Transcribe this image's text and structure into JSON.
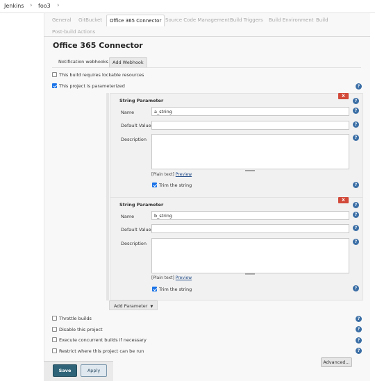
{
  "breadcrumb": {
    "items": [
      "Jenkins",
      "foo3"
    ],
    "separator": "›"
  },
  "tabs": [
    {
      "label": "General",
      "active": false
    },
    {
      "label": "GitBucket",
      "active": false
    },
    {
      "label": "Office 365 Connector",
      "active": true
    },
    {
      "label": "Source Code Management",
      "active": false
    },
    {
      "label": "Build Triggers",
      "active": false
    },
    {
      "label": "Build Environment",
      "active": false
    },
    {
      "label": "Build",
      "active": false
    },
    {
      "label": "Post-build Actions",
      "active": false
    }
  ],
  "section": {
    "title": "Office 365 Connector",
    "subtabs": [
      {
        "label": "Notification webhooks",
        "active": false
      },
      {
        "label": "Add Webhook",
        "active": true
      }
    ]
  },
  "options": {
    "lockable": {
      "label": "This build requires lockable resources",
      "checked": false
    },
    "parameterized": {
      "label": "This project is parameterized",
      "checked": true
    }
  },
  "parameters": [
    {
      "header": "String Parameter",
      "delete_label": "X",
      "name_label": "Name",
      "name_value": "a_string",
      "default_label": "Default Value",
      "default_value": "",
      "description_label": "Description",
      "plain_text": "[Plain text]",
      "preview": "Preview",
      "trim_label": "Trim the string",
      "trim_checked": true
    },
    {
      "header": "String Parameter",
      "delete_label": "X",
      "name_label": "Name",
      "name_value": "b_string",
      "default_label": "Default Value",
      "default_value": "",
      "description_label": "Description",
      "plain_text": "[Plain text]",
      "preview": "Preview",
      "trim_label": "Trim the string",
      "trim_checked": true
    }
  ],
  "add_parameter_label": "Add Parameter",
  "more_options": [
    {
      "label": "Throttle builds",
      "checked": false
    },
    {
      "label": "Disable this project",
      "checked": false
    },
    {
      "label": "Execute concurrent builds if necessary",
      "checked": false
    },
    {
      "label": "Restrict where this project can be run",
      "checked": false
    }
  ],
  "advanced_label": "Advanced...",
  "buttons": {
    "save": "Save",
    "apply": "Apply"
  },
  "help_glyph": "?",
  "colors": {
    "accent": "#2f6478",
    "delete": "#d24939",
    "help": "#3a6ea5",
    "link": "#204a87"
  }
}
